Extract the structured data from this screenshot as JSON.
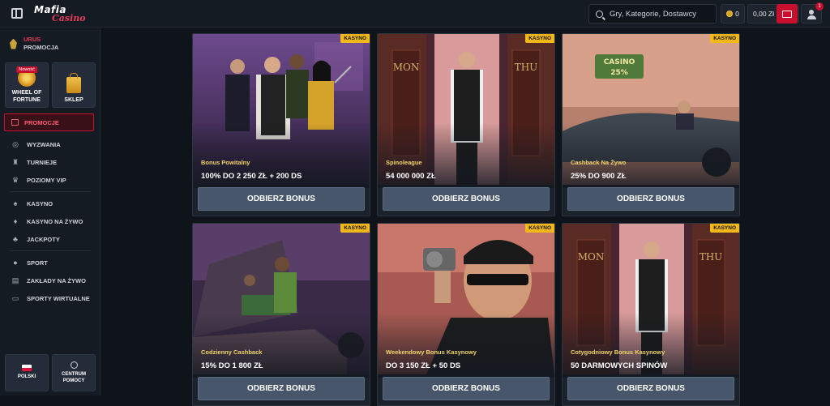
{
  "header": {
    "logo_top": "Mafia",
    "logo_bottom": "Casino",
    "search_placeholder": "Gry, Kategorie, Dostawcy",
    "coins": "0",
    "balance": "0,00 Zł",
    "notifications": "1"
  },
  "sidebar": {
    "rank_name": "URUS",
    "rank_sub": "PROMOCJA",
    "tiles": [
      {
        "label": "WHEEL OF FORTUNE",
        "badge": "Nowość"
      },
      {
        "label": "SKLEP"
      }
    ],
    "active_item": "PROMOCJE",
    "groups": [
      [
        {
          "label": "WYZWANIA",
          "icon": "target-icon"
        },
        {
          "label": "TURNIEJE",
          "icon": "trophy-icon"
        },
        {
          "label": "POZIOMY VIP",
          "icon": "crown-icon"
        }
      ],
      [
        {
          "label": "KASYNO",
          "icon": "spade-icon"
        },
        {
          "label": "KASYNO NA ŻYWO",
          "icon": "cards-icon"
        },
        {
          "label": "JACKPOTY",
          "icon": "clover-icon"
        }
      ],
      [
        {
          "label": "SPORT",
          "icon": "ball-icon"
        },
        {
          "label": "ZAKŁADY NA ŻYWO",
          "icon": "ticket-icon"
        },
        {
          "label": "SPORTY WIRTUALNE",
          "icon": "monitor-icon"
        }
      ]
    ],
    "language": "POLSKI",
    "help": "CENTRUM POMOCY"
  },
  "cards": [
    {
      "tag": "KASYNO",
      "title": "Bonus Powitalny",
      "value": "100% DO 2 250 ZŁ + 200 DS",
      "button": "ODBIERZ BONUS",
      "bg": "#5b3a7a"
    },
    {
      "tag": "KASYNO",
      "title": "Spinoleague",
      "value": "54 000 000 ZŁ",
      "button": "ODBIERZ BONUS",
      "bg": "#6a2f3a"
    },
    {
      "tag": "KASYNO",
      "title": "Cashback Na Żywo",
      "value": "25% DO 900 ZŁ",
      "button": "ODBIERZ BONUS",
      "bg": "#9a6a5e"
    },
    {
      "tag": "KASYNO",
      "title": "Codzienny Cashback",
      "value": "15% DO 1 800 ZŁ",
      "button": "ODBIERZ BONUS",
      "bg": "#4a2e52"
    },
    {
      "tag": "KASYNO",
      "title": "Weekendowy Bonus Kasynowy",
      "value": "DO 3 150 ZŁ + 50 DS",
      "button": "ODBIERZ BONUS",
      "bg": "#8a4a46"
    },
    {
      "tag": "KASYNO",
      "title": "Cotygodniowy Bonus Kasynowy",
      "value": "50 DARMOWYCH SPINÓW",
      "button": "ODBIERZ BONUS",
      "bg": "#6a2f3a"
    }
  ],
  "door_signs": {
    "left": "MON",
    "right": "THU",
    "casino_sign": "CASINO",
    "casino_pct": "25%"
  }
}
